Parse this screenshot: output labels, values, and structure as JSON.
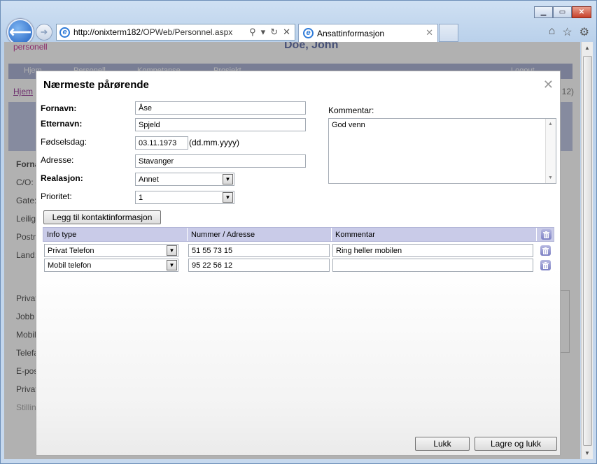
{
  "browser": {
    "address_url_host": "http://onixterm182",
    "address_url_path": "/OPWeb/Personnel.aspx",
    "tab_title": "Ansattinformasjon",
    "icons": [
      "back-icon",
      "forward-icon",
      "ie-icon",
      "search-icon",
      "dropdown-icon",
      "refresh-icon",
      "stop-icon",
      "home-icon",
      "favorites-icon",
      "gear-icon"
    ]
  },
  "page": {
    "logo_text": "personell",
    "employee_name": "Doe, John",
    "menu": [
      "Hjem",
      "Personell",
      "Kompetanse",
      "Prosjekt",
      "Logout"
    ],
    "breadcrumb": "Hjem",
    "breadcrumb_right": "12)",
    "side_labels": [
      "Forna",
      "C/O:",
      "Gate:",
      "Leilig",
      "Postn",
      "Land:",
      "Privat",
      "Jobb",
      "Mobil",
      "Telefa",
      "E-pos",
      "Privat",
      "Stillin"
    ]
  },
  "modal": {
    "title": "Nærmeste pårørende",
    "fields": {
      "fornavn_label": "Fornavn:",
      "fornavn_value": "Åse",
      "etternavn_label": "Etternavn:",
      "etternavn_value": "Spjeld",
      "fodselsdag_label": "Fødselsdag:",
      "fodselsdag_value": "03.11.1973",
      "fodselsdag_hint": "(dd.mm.yyyy)",
      "adresse_label": "Adresse:",
      "adresse_value": "Stavanger",
      "relasjon_label": "Realasjon:",
      "relasjon_value": "Annet",
      "prioritet_label": "Prioritet:",
      "prioritet_value": "1"
    },
    "kommentar_label": "Kommentar:",
    "kommentar_value": "God venn",
    "add_contact_button": "Legg til kontaktinformasjon",
    "table": {
      "headers": [
        "Info type",
        "Nummer / Adresse",
        "Kommentar"
      ],
      "rows": [
        {
          "type": "Privat Telefon",
          "number": "51 55 73 15",
          "comment": "Ring heller mobilen"
        },
        {
          "type": "Mobil telefon",
          "number": "95 22 56 12",
          "comment": ""
        }
      ]
    },
    "close_button": "Lukk",
    "save_close_button": "Lagre og lukk"
  }
}
